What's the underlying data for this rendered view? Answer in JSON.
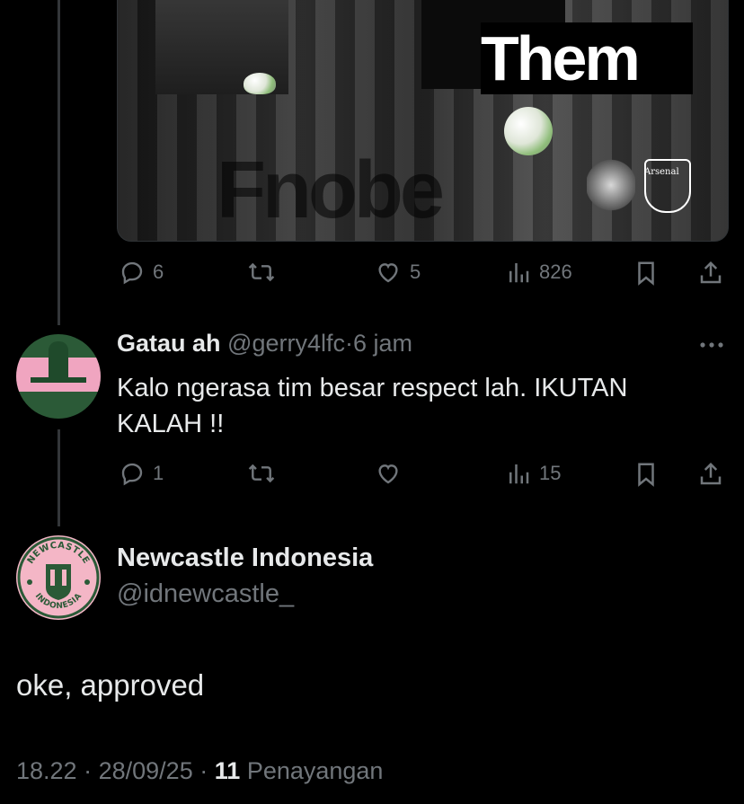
{
  "first_tweet": {
    "media": {
      "image_text": "Them",
      "club_label": "Arsenal"
    },
    "actions": {
      "replies": "6",
      "retweets": "",
      "likes": "5",
      "views": "826"
    }
  },
  "reply": {
    "display_name": "Gatau ah",
    "handle": "@gerry4lfc",
    "separator": "·",
    "time": "6 jam",
    "text_line1": "Kalo ngerasa tim besar respect lah. IKUTAN",
    "text_line2": "KALAH !!",
    "actions": {
      "replies": "1",
      "retweets": "",
      "likes": "",
      "views": "15"
    }
  },
  "main_tweet": {
    "display_name": "Newcastle Indonesia",
    "handle": "@idnewcastle_",
    "avatar_text_top": "NEWCASTLE",
    "avatar_text_bottom": "INDONESIA",
    "text": "oke, approved",
    "meta_time": "18.22",
    "meta_sep1": "·",
    "meta_date": "28/09/25",
    "meta_sep2": "·",
    "views_count": "11",
    "views_label": "Penayangan"
  },
  "colors": {
    "background": "#000000",
    "text_primary": "#e7e9ea",
    "text_secondary": "#71767b",
    "divider": "#333639",
    "avatar_pink": "#f4b6c6",
    "avatar_green": "#2b5a37"
  },
  "icons": [
    "reply-icon",
    "retweet-icon",
    "like-icon",
    "views-icon",
    "bookmark-icon",
    "share-icon",
    "more-icon"
  ]
}
